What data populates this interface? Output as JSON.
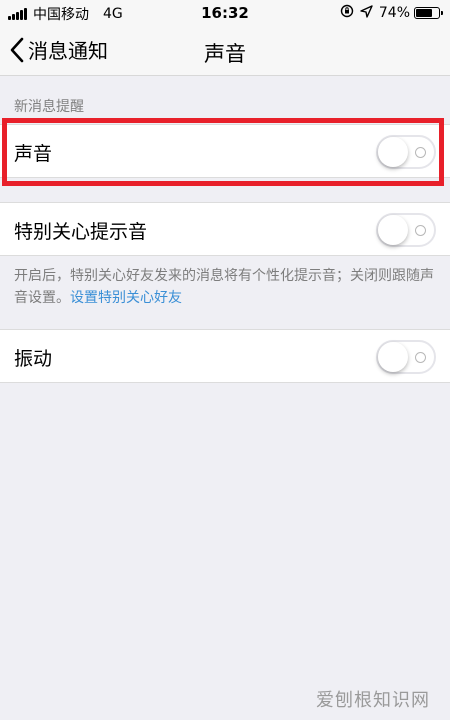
{
  "status_bar": {
    "carrier": "中国移动",
    "network": "4G",
    "time": "16:32",
    "battery": "74%",
    "battery_level": 0.74,
    "icons": [
      "lock-rotation-icon",
      "location-arrow-icon"
    ]
  },
  "nav": {
    "back_label": "消息通知",
    "title": "声音"
  },
  "section": {
    "header": "新消息提醒"
  },
  "settings": {
    "sound": {
      "label": "声音",
      "on": false
    },
    "special_care_tone": {
      "label": "特别关心提示音",
      "on": false
    },
    "vibration": {
      "label": "振动",
      "on": false
    }
  },
  "footer": {
    "note": "开启后，特别关心好友发来的消息将有个性化提示音；关闭则跟随声音设置。",
    "link": "设置特别关心好友"
  },
  "watermark": "爱刨根知识网",
  "colors": {
    "highlight": "#e8202a",
    "link": "#3a8fd6",
    "background": "#efeff4"
  }
}
